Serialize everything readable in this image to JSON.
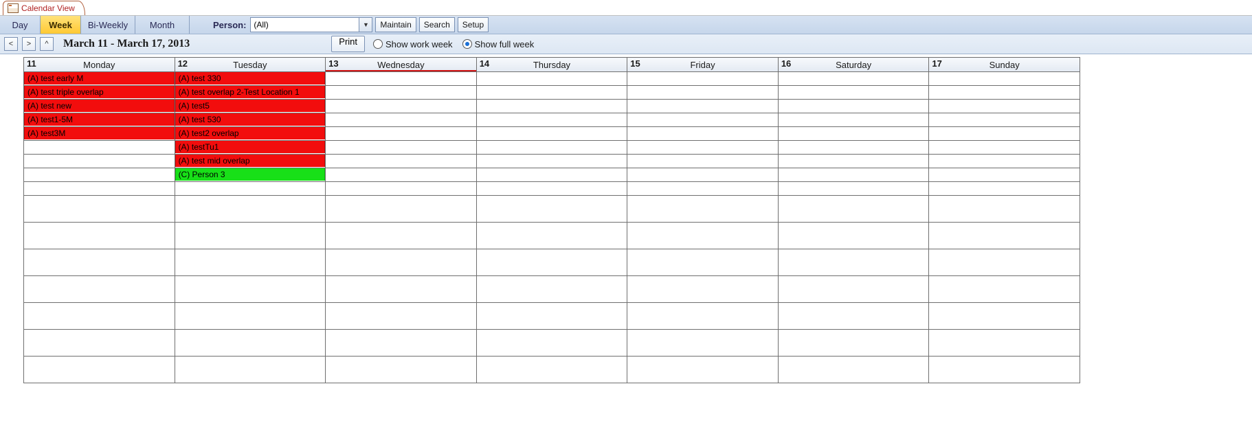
{
  "tab": {
    "title": "Calendar View"
  },
  "views": {
    "day": "Day",
    "week": "Week",
    "biweekly": "Bi-Weekly",
    "month": "Month",
    "active": "week"
  },
  "person": {
    "label": "Person:",
    "value": "(All)"
  },
  "buttons": {
    "maintain": "Maintain",
    "search": "Search",
    "setup": "Setup",
    "print": "Print"
  },
  "nav": {
    "prev": "<",
    "next": ">",
    "up": "^"
  },
  "range": "March 11 - March 17, 2013",
  "weekmode": {
    "work": "Show work week",
    "full": "Show full week",
    "selected": "full"
  },
  "days": [
    {
      "num": "11",
      "name": "Monday"
    },
    {
      "num": "12",
      "name": "Tuesday"
    },
    {
      "num": "13",
      "name": "Wednesday"
    },
    {
      "num": "14",
      "name": "Thursday"
    },
    {
      "num": "15",
      "name": "Friday"
    },
    {
      "num": "16",
      "name": "Saturday"
    },
    {
      "num": "17",
      "name": "Sunday"
    }
  ],
  "events": {
    "mon": [
      {
        "text": "(A) test early M",
        "color": "red"
      },
      {
        "text": "(A) test triple overlap",
        "color": "red"
      },
      {
        "text": "(A) test new",
        "color": "red"
      },
      {
        "text": "(A) test1-5M",
        "color": "red"
      },
      {
        "text": "(A) test3M",
        "color": "red"
      }
    ],
    "tue": [
      {
        "text": "(A) test 330",
        "color": "red"
      },
      {
        "text": "(A) test overlap 2-Test Location 1",
        "color": "red"
      },
      {
        "text": "(A) test5",
        "color": "red"
      },
      {
        "text": "(A) test 530",
        "color": "red"
      },
      {
        "text": "(A) test2 overlap",
        "color": "red"
      },
      {
        "text": "(A) testTu1",
        "color": "red"
      },
      {
        "text": "(A) test mid overlap",
        "color": "red"
      },
      {
        "text": "(C) Person 3",
        "color": "green"
      }
    ]
  }
}
